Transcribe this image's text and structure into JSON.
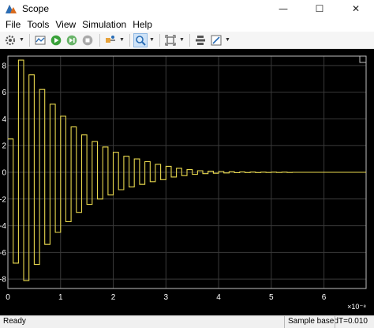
{
  "window": {
    "title": "Scope",
    "icon": "matlab-scope-icon"
  },
  "window_controls": {
    "minimize": "—",
    "maximize": "☐",
    "close": "✕"
  },
  "menu": [
    "File",
    "Tools",
    "View",
    "Simulation",
    "Help"
  ],
  "toolbar": {
    "buttons": [
      "settings-icon",
      "write-data-icon",
      "run-icon",
      "step-forward-icon",
      "stop-icon",
      "highlight-block-icon",
      "zoom-icon",
      "autoscale-icon",
      "triggers-icon",
      "style-icon"
    ]
  },
  "status": {
    "left": "Ready",
    "mode": "Sample based",
    "time": "T=0.010"
  },
  "colors": {
    "background": "#000000",
    "grid": "#3a3a3a",
    "trace": "#e8d84e",
    "axis_text": "#ffffff"
  },
  "chart_data": {
    "type": "line",
    "title": "",
    "xlabel": "",
    "ylabel": "",
    "x_exponent": "×10⁻⁸",
    "xlim": [
      0,
      6.8
    ],
    "ylim": [
      -8.7,
      8.7
    ],
    "x_ticks": [
      "0",
      "1",
      "2",
      "3",
      "4",
      "5",
      "6"
    ],
    "y_ticks": [
      "8",
      "6",
      "4",
      "2",
      "0",
      "-2",
      "-4",
      "-6",
      "-8"
    ],
    "grid": true,
    "series": [
      {
        "step": 0.1,
        "values": [
          2.5,
          -6.8,
          8.4,
          -8.1,
          7.3,
          -6.9,
          6.2,
          -5.4,
          5.1,
          -4.5,
          4.2,
          -3.7,
          3.4,
          -3.0,
          2.8,
          -2.4,
          2.3,
          -2.0,
          1.9,
          -1.7,
          1.5,
          -1.3,
          1.2,
          -1.1,
          1.0,
          -0.9,
          0.8,
          -0.7,
          0.6,
          -0.55,
          0.45,
          -0.35,
          0.3,
          -0.25,
          0.2,
          -0.15,
          0.12,
          -0.1,
          0.08,
          -0.07,
          0.06,
          -0.05,
          0.04,
          -0.03,
          0.03,
          -0.02,
          0.02,
          -0.02,
          0.01,
          -0.01,
          0.01,
          -0.01,
          0.01,
          -0.01,
          0.0,
          0.0,
          0.0,
          0.0,
          0.0,
          0.0,
          0.0,
          0.0,
          0.0,
          0.0,
          0.0,
          0.0,
          0.0,
          0.0
        ]
      }
    ]
  }
}
